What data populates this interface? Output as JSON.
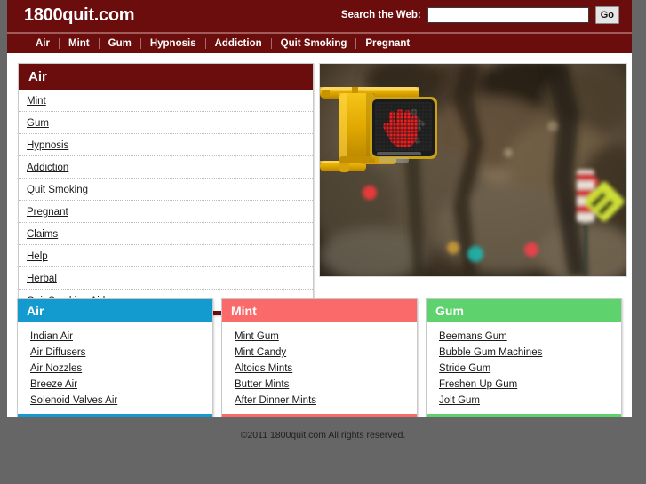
{
  "header": {
    "logo": "1800quit.com",
    "search_label": "Search the Web:",
    "search_value": "",
    "search_placeholder": "",
    "go_label": "Go"
  },
  "nav": {
    "items": [
      {
        "label": "Air"
      },
      {
        "label": "Mint"
      },
      {
        "label": "Gum"
      },
      {
        "label": "Hypnosis"
      },
      {
        "label": "Addiction"
      },
      {
        "label": "Quit Smoking"
      },
      {
        "label": "Pregnant"
      }
    ]
  },
  "main_panel": {
    "title": "Air",
    "accent": "#6b0d0d",
    "items": [
      {
        "label": "Mint"
      },
      {
        "label": "Gum"
      },
      {
        "label": "Hypnosis"
      },
      {
        "label": "Addiction"
      },
      {
        "label": "Quit Smoking"
      },
      {
        "label": "Pregnant"
      },
      {
        "label": "Claims"
      },
      {
        "label": "Help"
      },
      {
        "label": "Herbal"
      },
      {
        "label": "Quit Smoking Aids"
      }
    ]
  },
  "hero": {
    "alt": "Pedestrian crossing signal showing a red stop hand with blurred autumn trees in the background"
  },
  "categories": [
    {
      "title": "Air",
      "accent": "#139bd0",
      "items": [
        {
          "label": "Indian Air"
        },
        {
          "label": "Air Diffusers"
        },
        {
          "label": "Air Nozzles"
        },
        {
          "label": "Breeze Air"
        },
        {
          "label": "Solenoid Valves Air"
        }
      ]
    },
    {
      "title": "Mint",
      "accent": "#fa6a6a",
      "items": [
        {
          "label": "Mint Gum"
        },
        {
          "label": "Mint Candy"
        },
        {
          "label": "Altoids Mints"
        },
        {
          "label": "Butter Mints"
        },
        {
          "label": "After Dinner Mints"
        }
      ]
    },
    {
      "title": "Gum",
      "accent": "#5ed36d",
      "items": [
        {
          "label": "Beemans Gum"
        },
        {
          "label": "Bubble Gum Machines"
        },
        {
          "label": "Stride Gum"
        },
        {
          "label": "Freshen Up Gum"
        },
        {
          "label": "Jolt Gum"
        }
      ]
    }
  ],
  "footer": {
    "copyright": "©2011 1800quit.com All rights reserved."
  }
}
